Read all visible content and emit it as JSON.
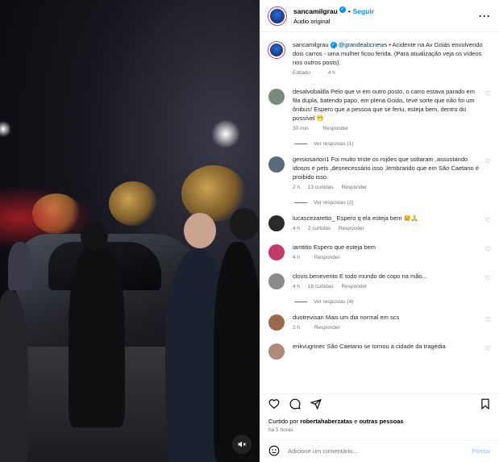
{
  "header": {
    "username": "sancamilgrau",
    "separator": "•",
    "follow_label": "Seguir",
    "audio_label": "Áudio original",
    "more_icon": "more-horizontal-icon"
  },
  "caption": {
    "username": "sancamilgrau",
    "mention": "@grandeabcnews",
    "text": " • Acidente na Av Goiás envolvendo dois carros - uma mulher ficou ferida. (Para atualização veja os vídeos nos outros posts).",
    "edited": "Editado",
    "separator": "·",
    "time": "4 h"
  },
  "comments": [
    {
      "user": "desalvobalilla",
      "text": "Pelo que vi em outro posto, o carro estava parado em fila dupla, batendo papo, em plena Goiás, teve sorte que não foi um ônibus! Espero que a pessoa que se feriu, esteja bem, dentro do possível 😬",
      "time": "30 min",
      "likes": "",
      "reply": "Responder",
      "replies": "Ver respostas (1)",
      "avatar_color": "#7a8a7a"
    },
    {
      "user": "gersiosartori1",
      "text": "Foi muito triste os rojões que soltaram ,assustando idosos e pets ,desnecessário isso ,lembrando que em São Caetano é proibido isso.",
      "time": "2 h",
      "likes": "13 curtidas",
      "reply": "Responder",
      "replies": "Ver respostas (2)",
      "avatar_color": "#5a6a7a"
    },
    {
      "user": "lucascezaretto_",
      "text": "Espero q ela esteja bem 😢🙏",
      "time": "4 h",
      "likes": "2 curtidas",
      "reply": "Responder",
      "replies": "",
      "avatar_color": "#2a2a2a"
    },
    {
      "user": "iamtitio",
      "text": "Espero que esteja bem",
      "time": "4 h",
      "likes": "",
      "reply": "Responder",
      "replies": "",
      "avatar_color": "#c23a6a"
    },
    {
      "user": "clovis.benevento",
      "text": "E todo mundo de copo na mão...",
      "time": "4 h",
      "likes": "16 curtidas",
      "reply": "Responder",
      "replies": "Ver respostas (4)",
      "avatar_color": "#8a8a8a"
    },
    {
      "user": "duotrevisan",
      "text": "Mais um dia normal em scs",
      "time": "2 h",
      "likes": "",
      "reply": "Responder",
      "replies": "",
      "avatar_color": "#9a6a4a"
    },
    {
      "user": "erikvugrinec",
      "text": "São Caetano se tornou a cidade da tragédia",
      "time": "",
      "likes": "",
      "reply": "",
      "replies": "",
      "avatar_color": "#b08a7a"
    }
  ],
  "actions": {
    "like_icon": "heart-icon",
    "comment_icon": "comment-icon",
    "share_icon": "send-icon",
    "save_icon": "bookmark-icon"
  },
  "liked_by": {
    "prefix": "Curtido por ",
    "user": "robertahaberzatas",
    "suffix": " e ",
    "others": "outras pessoas"
  },
  "posted_ago": "há 5 horas",
  "add_comment": {
    "emoji_icon": "smiley-icon",
    "placeholder": "Adicione um comentário...",
    "post_label": "Postar"
  },
  "video": {
    "mute_icon": "speaker-muted-icon"
  }
}
